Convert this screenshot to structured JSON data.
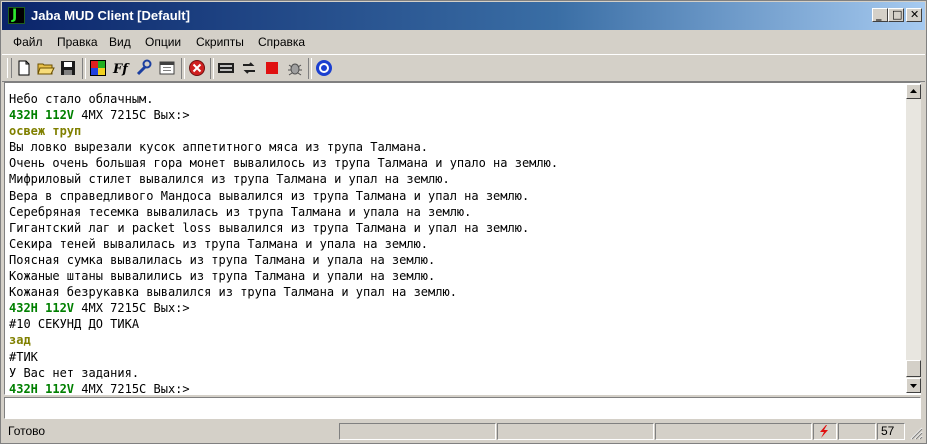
{
  "window": {
    "title": "Jaba MUD Client [Default]",
    "app_icon_letter": "J",
    "controls": {
      "minimize": "_",
      "maximize": "□",
      "close": "✕"
    }
  },
  "menu": [
    "Файл",
    "Правка",
    "Вид",
    "Опции",
    "Скрипты",
    "Справка"
  ],
  "toolbar": {
    "buttons": [
      "new-file-icon",
      "open-folder-icon",
      "save-icon",
      "colors-icon",
      "fonts-icon",
      "settings-wrench-icon",
      "window-icon",
      "disconnect-icon",
      "log-icon",
      "reconnect-icon",
      "stop-icon",
      "debug-bug-icon",
      "help-icon"
    ],
    "fonts_label": "Ff"
  },
  "output": {
    "lines": [
      {
        "kind": "text",
        "text": "Небо стало облачным."
      },
      {
        "kind": "prompt",
        "green": "432H 112V",
        "rest": " 4MX 7215C Вых:>"
      },
      {
        "kind": "echo",
        "text": "освеж труп"
      },
      {
        "kind": "text",
        "text": "Вы ловко вырезали кусок аппетитного мяса из трупа Талмана."
      },
      {
        "kind": "text",
        "text": "Очень очень большая гора монет вывалилось из трупа Талмана и упало на землю."
      },
      {
        "kind": "text",
        "text": "Мифриловый стилет вывалился из трупа Талмана и упал на землю."
      },
      {
        "kind": "text",
        "text": "Вера в справедливого Мандоса вывалился из трупа Талмана и упал на землю."
      },
      {
        "kind": "text",
        "text": "Серебряная тесемка вывалилась из трупа Талмана и упала на землю."
      },
      {
        "kind": "text",
        "text": "Гигантский лаг и packet loss вывалился из трупа Талмана и упал на землю."
      },
      {
        "kind": "text",
        "text": "Секира теней вывалилась из трупа Талмана и упала на землю."
      },
      {
        "kind": "text",
        "text": "Поясная сумка вывалилась из трупа Талмана и упала на землю."
      },
      {
        "kind": "text",
        "text": "Кожаные штаны вывалились из трупа Талмана и упали на землю."
      },
      {
        "kind": "text",
        "text": "Кожаная безрукавка вывалился из трупа Талмана и упал на землю."
      },
      {
        "kind": "prompt",
        "green": "432H 112V",
        "rest": " 4MX 7215C Вых:>"
      },
      {
        "kind": "text",
        "text": "#10 СЕКУНД ДО ТИКА"
      },
      {
        "kind": "echo",
        "text": "зад"
      },
      {
        "kind": "text",
        "text": "#ТИК"
      },
      {
        "kind": "text",
        "text": "У Вас нет задания."
      },
      {
        "kind": "prompt",
        "green": "432H 112V",
        "rest": " 4MX 7215C Вых:>"
      }
    ]
  },
  "command_input": {
    "value": "",
    "placeholder": ""
  },
  "statusbar": {
    "status_text": "Готово",
    "panels": [
      "",
      "",
      ""
    ],
    "counter": "57"
  },
  "colors": {
    "prompt_green": "#008000",
    "echo_olive": "#808000",
    "titlebar_start": "#0a246a",
    "titlebar_end": "#a6caf0"
  }
}
